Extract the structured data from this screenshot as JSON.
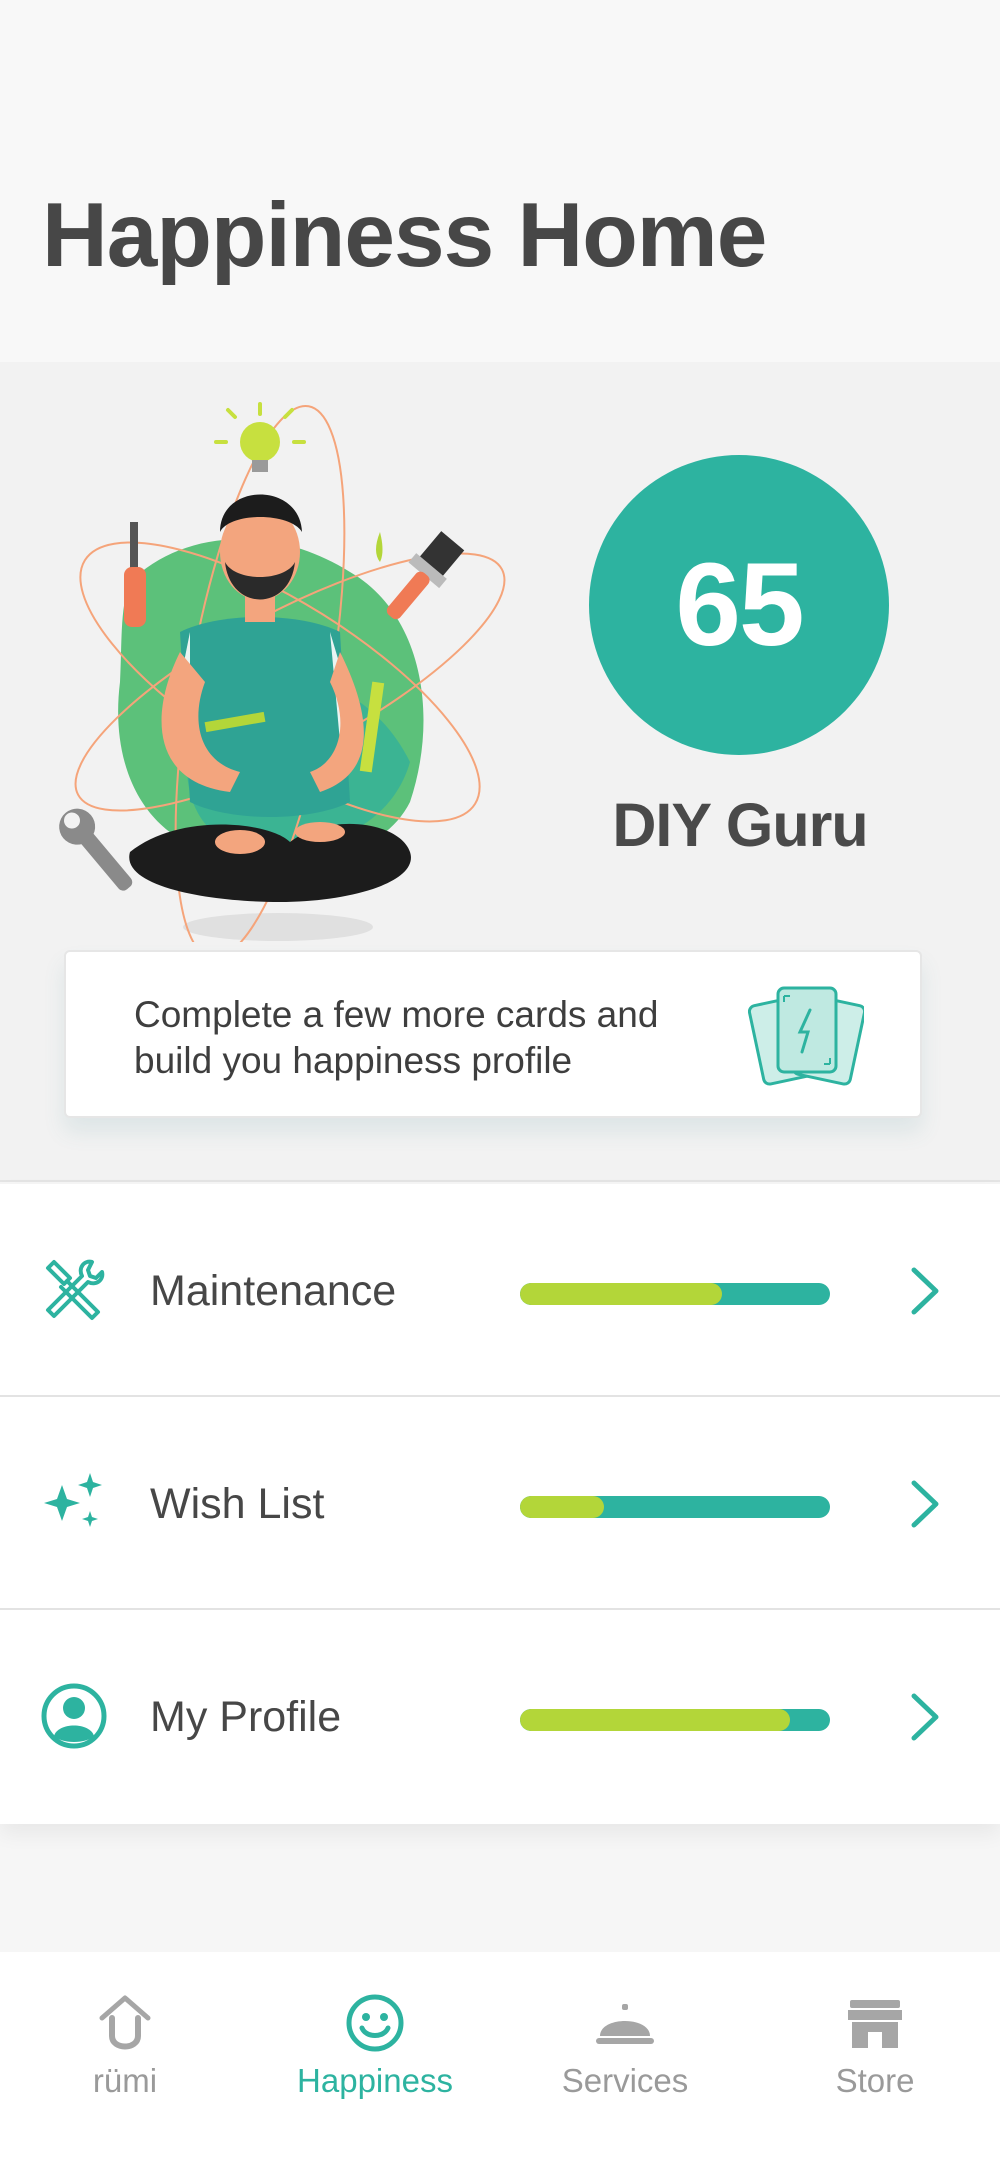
{
  "header": {
    "title": "Happiness Home"
  },
  "hero": {
    "score": "65",
    "level_title": "DIY Guru",
    "prompt_text": "Complete a few more cards and build you happiness profile"
  },
  "categories": [
    {
      "label": "Maintenance",
      "icon": "tools-icon",
      "progress": 0.65
    },
    {
      "label": "Wish List",
      "icon": "sparkles-icon",
      "progress": 0.27
    },
    {
      "label": "My Profile",
      "icon": "profile-icon",
      "progress": 0.87
    }
  ],
  "tabbar": {
    "tabs": [
      {
        "label": "rümi",
        "icon": "home-icon",
        "active": false
      },
      {
        "label": "Happiness",
        "icon": "smiley-icon",
        "active": true
      },
      {
        "label": "Services",
        "icon": "service-bell-icon",
        "active": false
      },
      {
        "label": "Store",
        "icon": "store-icon",
        "active": false
      }
    ]
  },
  "colors": {
    "accent": "#2db3a0",
    "progress_fill": "#b3d639",
    "text": "#474747",
    "inactive": "#9a9a9a"
  }
}
